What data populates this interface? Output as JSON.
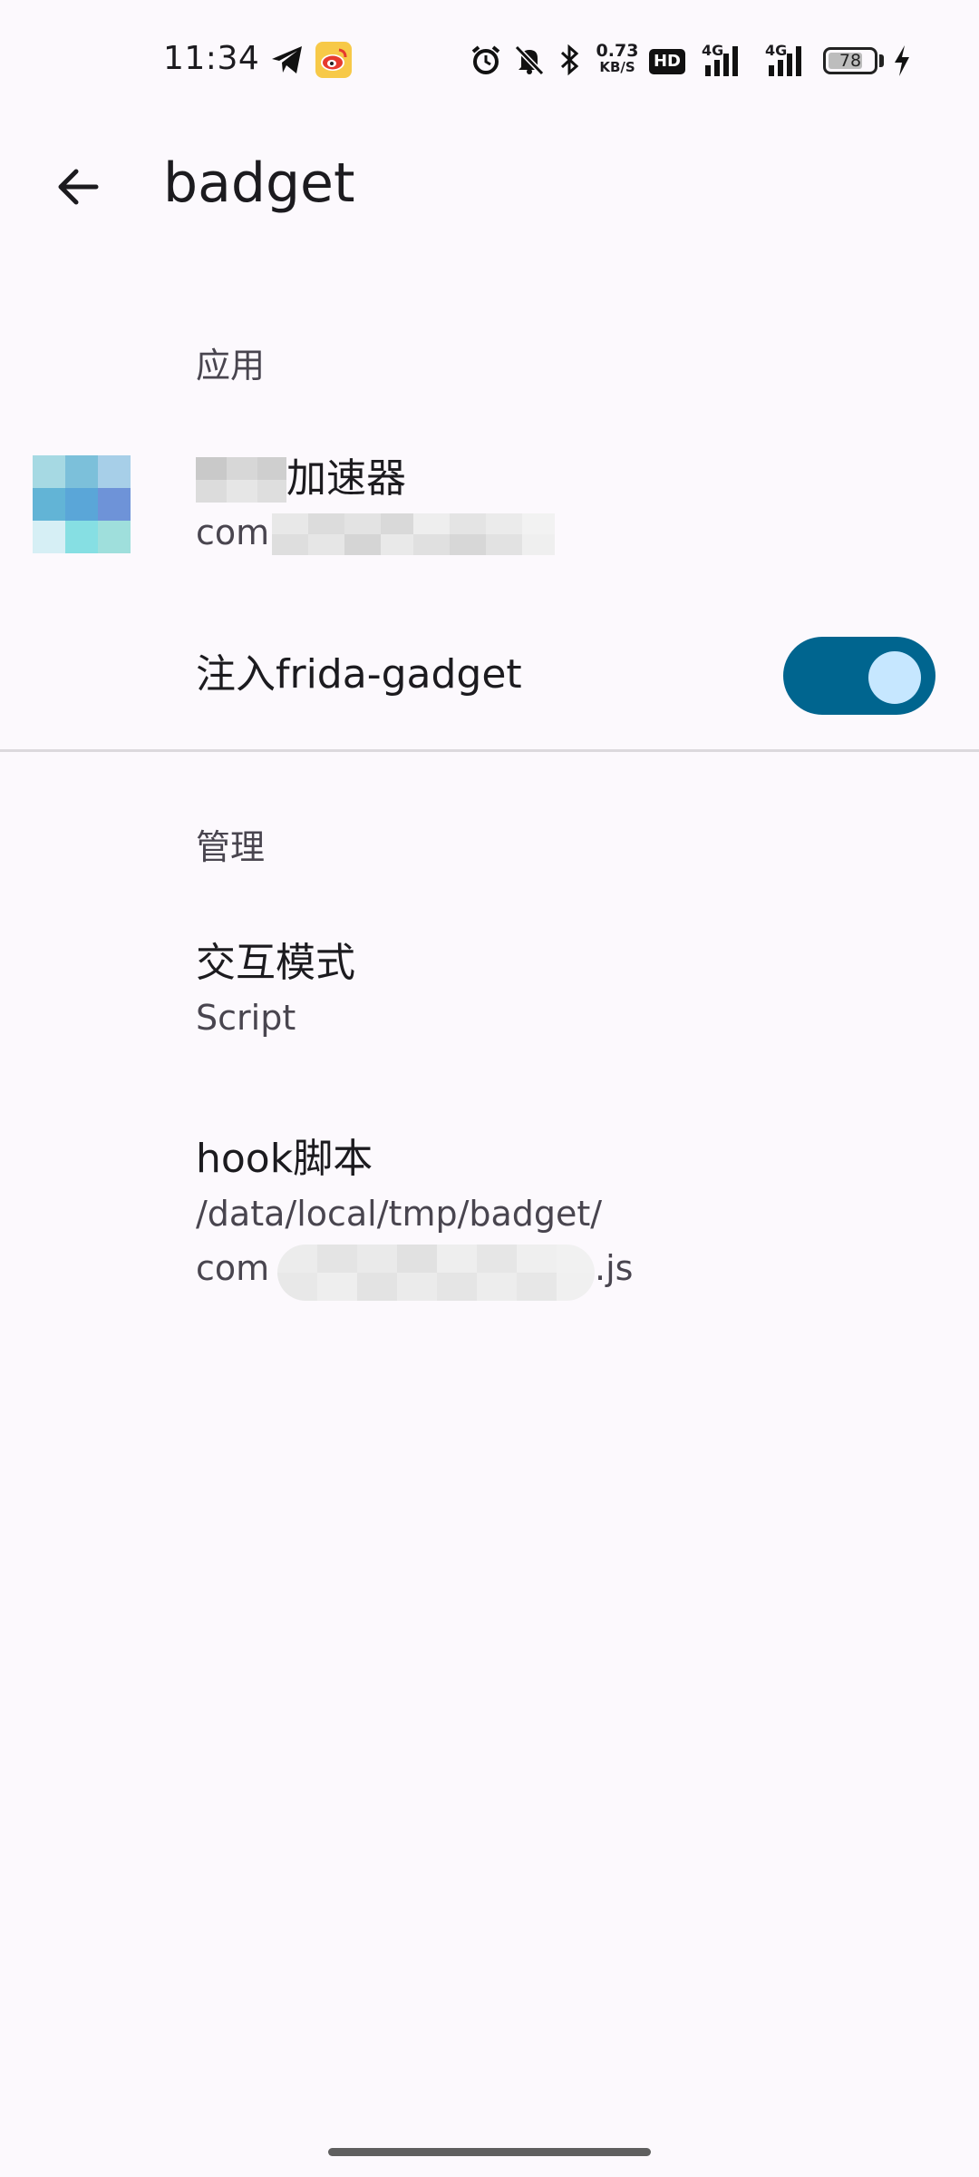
{
  "status_bar": {
    "time": "11:34",
    "net_speed_value": "0.73",
    "net_speed_unit": "KB/S",
    "hd_label": "HD",
    "signal1_label": "4G",
    "signal2_label": "4G",
    "battery_level": "78",
    "battery_fraction": 0.78,
    "icons": [
      "telegram-icon",
      "weibo-icon",
      "alarm-icon",
      "mute-icon",
      "bluetooth-icon",
      "charging-icon"
    ]
  },
  "app_bar": {
    "title": "badget"
  },
  "sections": {
    "app": {
      "header": "应用",
      "app_name": "加速器",
      "package_prefix": "com"
    },
    "injection": {
      "label": "注入frida-gadget",
      "enabled": true
    },
    "manage": {
      "header": "管理",
      "mode_title": "交互模式",
      "mode_value": "Script",
      "script_title": "hook脚本",
      "script_path_line1": "/data/local/tmp/badget/",
      "script_path_prefix": "com",
      "script_path_suffix": ".js"
    }
  },
  "colors": {
    "background": "#fcf9fd",
    "switch_track": "#00658f",
    "switch_thumb": "#c6e7ff",
    "secondary_text": "#49454f"
  }
}
